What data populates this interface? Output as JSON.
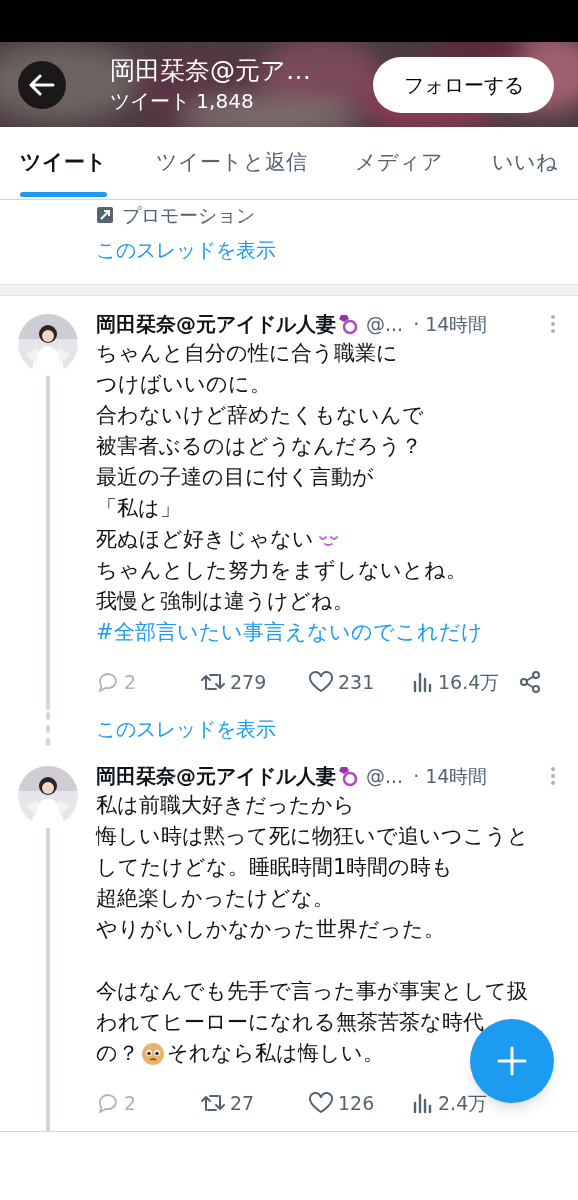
{
  "header": {
    "title": "岡田栞奈@元ア…",
    "subtitle": "ツイート 1,848",
    "follow_button": "フォローする"
  },
  "tabs": [
    {
      "label": "ツイート",
      "selected": true
    },
    {
      "label": "ツイートと返信",
      "selected": false
    },
    {
      "label": "メディア",
      "selected": false
    },
    {
      "label": "いいね",
      "selected": false
    }
  ],
  "top_item": {
    "promotion": "プロモーション",
    "thread_link": "このスレッドを表示"
  },
  "tweets": [
    {
      "name": "岡田栞奈@元アイドル人妻",
      "handle": "@...",
      "time": "· 14時間",
      "lines": [
        [
          {
            "kind": "text",
            "text": "ちゃんと自分の性に合う職業に"
          }
        ],
        [
          {
            "kind": "text",
            "text": "つけばいいのに。"
          }
        ],
        [
          {
            "kind": "text",
            "text": "合わないけど辞めたくもないんで"
          }
        ],
        [
          {
            "kind": "text",
            "text": "被害者ぶるのはどうなんだろう？"
          }
        ],
        [
          {
            "kind": "text",
            "text": "最近の子達の目に付く言動が"
          }
        ],
        [
          {
            "kind": "text",
            "text": "「私は」"
          }
        ],
        [
          {
            "kind": "text",
            "text": "死ぬほど好きじゃない"
          },
          {
            "kind": "smile_mark"
          }
        ],
        [
          {
            "kind": "text",
            "text": "ちゃんとした努力をまずしないとね。"
          }
        ],
        [
          {
            "kind": "text",
            "text": "我慢と強制は違うけどね。"
          }
        ],
        [
          {
            "kind": "hashtag",
            "text": "#全部言いたい事言えないのでこれだけ"
          }
        ]
      ],
      "stats": {
        "replies": "2",
        "retweets": "279",
        "likes": "231",
        "views": "16.4万"
      },
      "share_visible": true,
      "thread_link": "このスレッドを表示"
    },
    {
      "name": "岡田栞奈@元アイドル人妻",
      "handle": "@...",
      "time": "· 14時間",
      "lines": [
        [
          {
            "kind": "text",
            "text": "私は前職大好きだったから"
          }
        ],
        [
          {
            "kind": "text",
            "text": "悔しい時は黙って死に物狂いで追いつこうと"
          }
        ],
        [
          {
            "kind": "text",
            "text": "してたけどな。睡眠時間1時間の時も"
          }
        ],
        [
          {
            "kind": "text",
            "text": "超絶楽しかったけどな。"
          }
        ],
        [
          {
            "kind": "text",
            "text": "やりがいしかなかった世界だった。"
          }
        ],
        [
          {
            "kind": "blank"
          }
        ],
        [
          {
            "kind": "text",
            "text": "今はなんでも先手で言った事が事実として扱"
          }
        ],
        [
          {
            "kind": "text",
            "text": "われてヒーローになれる無茶苦茶な時代"
          }
        ],
        [
          {
            "kind": "text",
            "text": "の？"
          },
          {
            "kind": "pleading_emoji"
          },
          {
            "kind": "text",
            "text": "それなら私は悔しい。"
          }
        ]
      ],
      "stats": {
        "replies": "2",
        "retweets": "27",
        "likes": "126",
        "views": "2.4万"
      },
      "share_visible": false
    }
  ]
}
